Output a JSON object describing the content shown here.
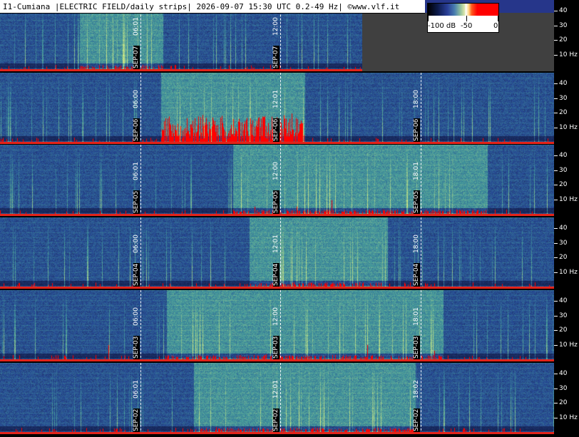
{
  "header": {
    "title": "I1-Cumiana |ELECTRIC FIELD/daily strips| 2026-09-07 15:30 UTC 0.2-49 Hz| ©www.vlf.it"
  },
  "colorbar": {
    "labels": [
      "-100 dB",
      "-50",
      "0"
    ],
    "stops": [
      "#000000",
      "#2a3f98",
      "#8fbf9f",
      "#ffffff",
      "#ff5a1e",
      "#ff0000"
    ]
  },
  "scale_labels": [
    "40",
    "30",
    "20",
    "10 Hz"
  ],
  "strips": [
    {
      "date": "SEP-07",
      "markers": [
        "06:01",
        "12:00"
      ],
      "activity": [
        0.22,
        0.45
      ],
      "storm": 0.05,
      "data_end_fraction": 0.654
    },
    {
      "date": "SEP-06",
      "markers": [
        "06:00",
        "12:01",
        "18:00"
      ],
      "activity": [
        0.29,
        0.55
      ],
      "storm": 0.85,
      "data_end_fraction": 1
    },
    {
      "date": "SEP-05",
      "markers": [
        "06:01",
        "12:00",
        "18:01"
      ],
      "activity": [
        0.42,
        0.88
      ],
      "storm": 0.08,
      "data_end_fraction": 1
    },
    {
      "date": "SEP-04",
      "markers": [
        "06:00",
        "12:01",
        "18:00"
      ],
      "activity": [
        0.45,
        0.7
      ],
      "storm": 0.03,
      "data_end_fraction": 1
    },
    {
      "date": "SEP-03",
      "markers": [
        "06:00",
        "12:00",
        "18:01"
      ],
      "activity": [
        0.3,
        0.8
      ],
      "storm": 0.03,
      "data_end_fraction": 1
    },
    {
      "date": "SEP-02",
      "markers": [
        "06:01",
        "12:01",
        "18:02"
      ],
      "activity": [
        0.35,
        0.75
      ],
      "storm": 0.06,
      "data_end_fraction": 1
    }
  ],
  "colors": {
    "background": "#26368a",
    "burst": "#ff0000",
    "separator": "#e2231a",
    "nodata": "#404040"
  }
}
